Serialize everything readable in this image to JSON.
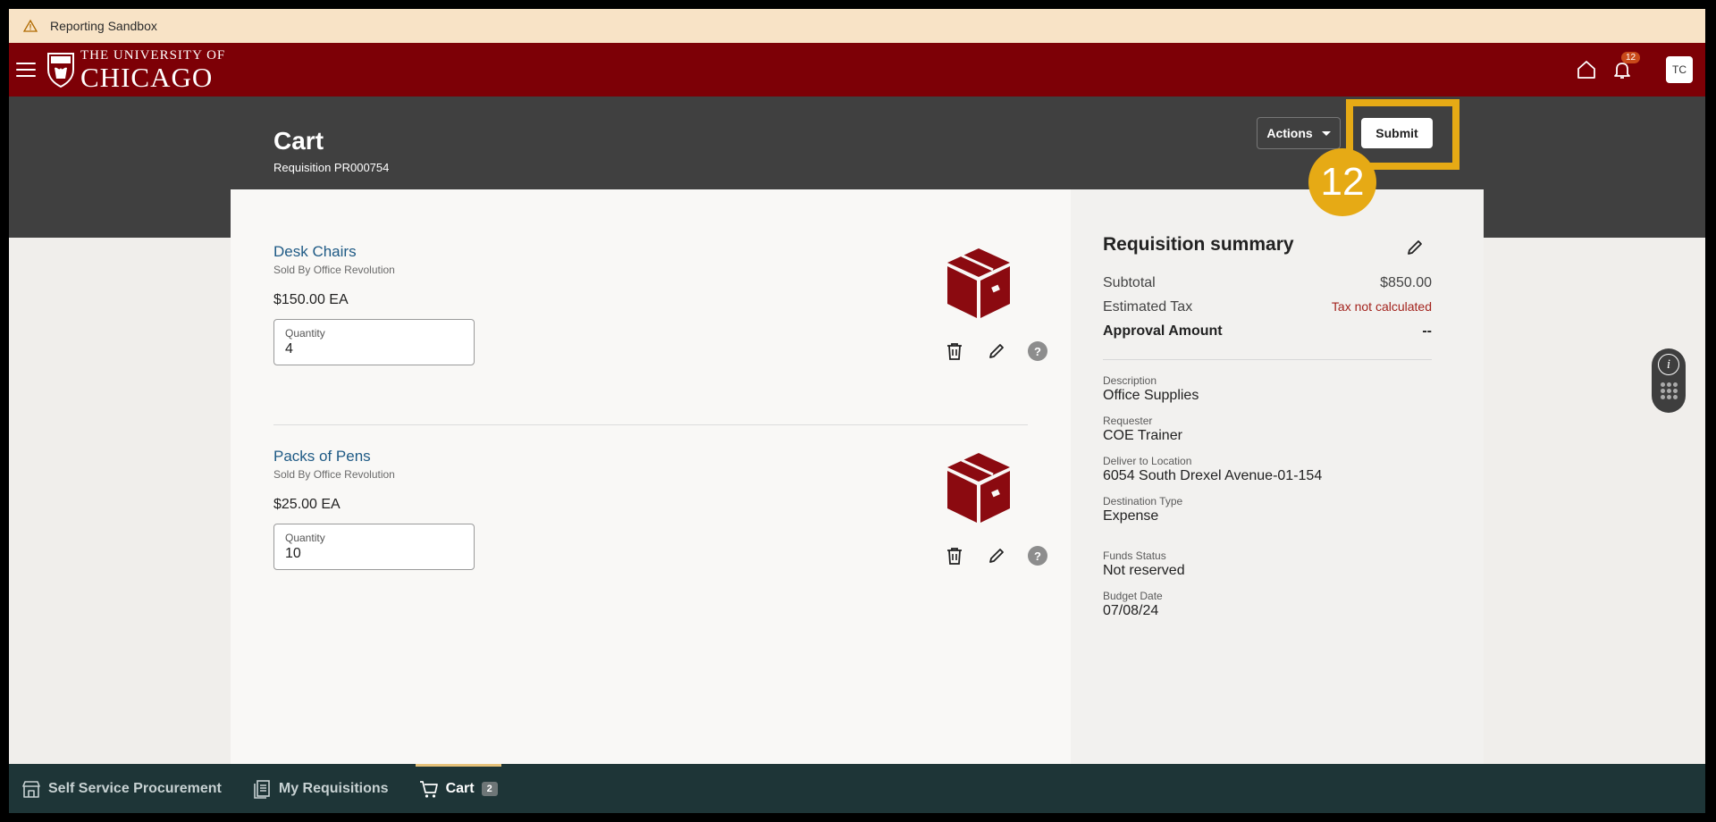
{
  "sandbox": {
    "label": "Reporting Sandbox"
  },
  "brand": {
    "line1": "THE UNIVERSITY OF",
    "line2": "CHICAGO"
  },
  "header": {
    "notification_count": "12",
    "avatar_initials": "TC"
  },
  "page": {
    "title": "Cart",
    "subtitle": "Requisition PR000754"
  },
  "toolbar": {
    "actions_label": "Actions",
    "submit_label": "Submit"
  },
  "tutorial": {
    "step_number": "12",
    "highlight_color": "#e6aa15"
  },
  "items": [
    {
      "name": "Desk Chairs",
      "sold_by": "Sold By Office Revolution",
      "price": "$150.00 EA",
      "quantity_label": "Quantity",
      "quantity": "4"
    },
    {
      "name": "Packs of Pens",
      "sold_by": "Sold By Office Revolution",
      "price": "$25.00 EA",
      "quantity_label": "Quantity",
      "quantity": "10"
    }
  ],
  "summary": {
    "title": "Requisition summary",
    "subtotal_label": "Subtotal",
    "subtotal_value": "$850.00",
    "tax_label": "Estimated Tax",
    "tax_value": "Tax not calculated",
    "approval_label": "Approval Amount",
    "approval_value": "--",
    "fields": [
      {
        "label": "Description",
        "value": "Office Supplies"
      },
      {
        "label": "Requester",
        "value": "COE Trainer"
      },
      {
        "label": "Deliver to Location",
        "value": "6054 South Drexel Avenue-01-154"
      },
      {
        "label": "Destination Type",
        "value": "Expense"
      },
      {
        "label": "Funds Status",
        "value": "Not reserved"
      },
      {
        "label": "Budget Date",
        "value": "07/08/24"
      }
    ]
  },
  "bottom_nav": {
    "items": [
      {
        "label": "Self Service Procurement",
        "icon": "store-icon"
      },
      {
        "label": "My Requisitions",
        "icon": "requisitions-icon"
      },
      {
        "label": "Cart",
        "icon": "cart-icon",
        "badge": "2"
      }
    ]
  },
  "colors": {
    "brand": "#7d0006",
    "dark_header": "#404040",
    "bottom_nav": "#1e3537",
    "link": "#1e5a85"
  }
}
